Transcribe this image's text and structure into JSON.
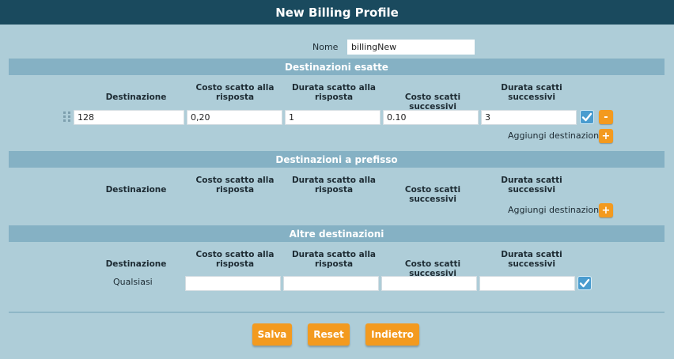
{
  "window": {
    "title": "New Billing Profile"
  },
  "profile": {
    "name_label": "Nome",
    "name_value": "billingNew"
  },
  "columns": {
    "destinazione": "Destinazione",
    "costo_risposta": "Costo scatto alla risposta",
    "durata_risposta": "Durata scatto alla risposta",
    "costo_successivi": "Costo scatti successivi",
    "durata_successivi": "Durata scatti successivi"
  },
  "sections": {
    "esatte": {
      "title": "Destinazioni esatte",
      "row": {
        "destinazione": "128",
        "costo_risposta": "0,20",
        "durata_risposta": "1",
        "costo_successivi": "0.10",
        "durata_successivi": "3"
      },
      "remove_label": "-",
      "add_label": "Aggiungi destinazione",
      "add_icon": "+"
    },
    "prefisso": {
      "title": "Destinazioni a prefisso",
      "add_label": "Aggiungi destinazione",
      "add_icon": "+"
    },
    "altre": {
      "title": "Altre destinazioni",
      "row_label": "Qualsiasi",
      "row": {
        "costo_risposta": "",
        "durata_risposta": "",
        "costo_successivi": "",
        "durata_successivi": ""
      }
    }
  },
  "buttons": {
    "save": "Salva",
    "reset": "Reset",
    "back": "Indietro"
  },
  "colors": {
    "titlebar": "#1a4a5e",
    "background": "#aecdd8",
    "section": "#85b1c4",
    "accent": "#f39a1f",
    "checkbox": "#4a9ccf"
  }
}
